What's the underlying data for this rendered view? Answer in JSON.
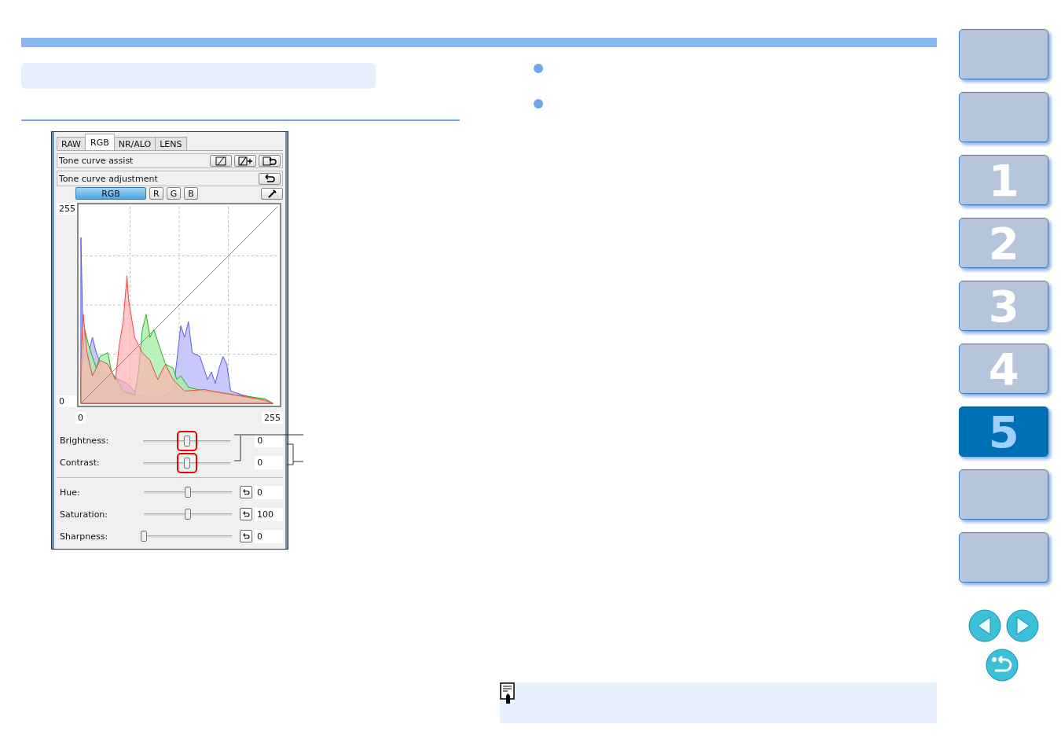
{
  "panel": {
    "tabs": [
      {
        "label": "RAW",
        "selected": false
      },
      {
        "label": "RGB",
        "selected": true
      },
      {
        "label": "NR/ALO",
        "selected": false
      },
      {
        "label": "LENS",
        "selected": false
      }
    ],
    "tone_curve_assist": {
      "label": "Tone curve assist"
    },
    "tone_curve_adjustment": {
      "label": "Tone curve adjustment"
    },
    "channels": [
      {
        "label": "RGB",
        "selected": true
      },
      {
        "label": "R",
        "selected": false
      },
      {
        "label": "G",
        "selected": false
      },
      {
        "label": "B",
        "selected": false
      }
    ],
    "curve": {
      "y_max": "255",
      "y_min": "0",
      "x_min": "0",
      "x_max": "255"
    },
    "sliders": [
      {
        "label": "Brightness:",
        "level": 0.5,
        "value": "0",
        "highlighted": true,
        "reset": false
      },
      {
        "label": "Contrast:",
        "level": 0.5,
        "value": "0",
        "highlighted": true,
        "reset": false
      },
      {
        "label": "Hue:",
        "level": 0.5,
        "value": "0",
        "highlighted": false,
        "reset": true
      },
      {
        "label": "Saturation:",
        "level": 0.5,
        "value": "100",
        "highlighted": false,
        "reset": true
      },
      {
        "label": "Sharpness:",
        "level": 0,
        "value": "0",
        "highlighted": false,
        "reset": true
      }
    ]
  },
  "nav": [
    {
      "selected": false
    },
    {
      "selected": false
    },
    {
      "label": "1",
      "selected": false
    },
    {
      "label": "2",
      "selected": false
    },
    {
      "label": "3",
      "selected": false
    },
    {
      "label": "4",
      "selected": false
    },
    {
      "label": "5",
      "selected": true
    },
    {
      "selected": false
    },
    {
      "selected": false
    }
  ]
}
